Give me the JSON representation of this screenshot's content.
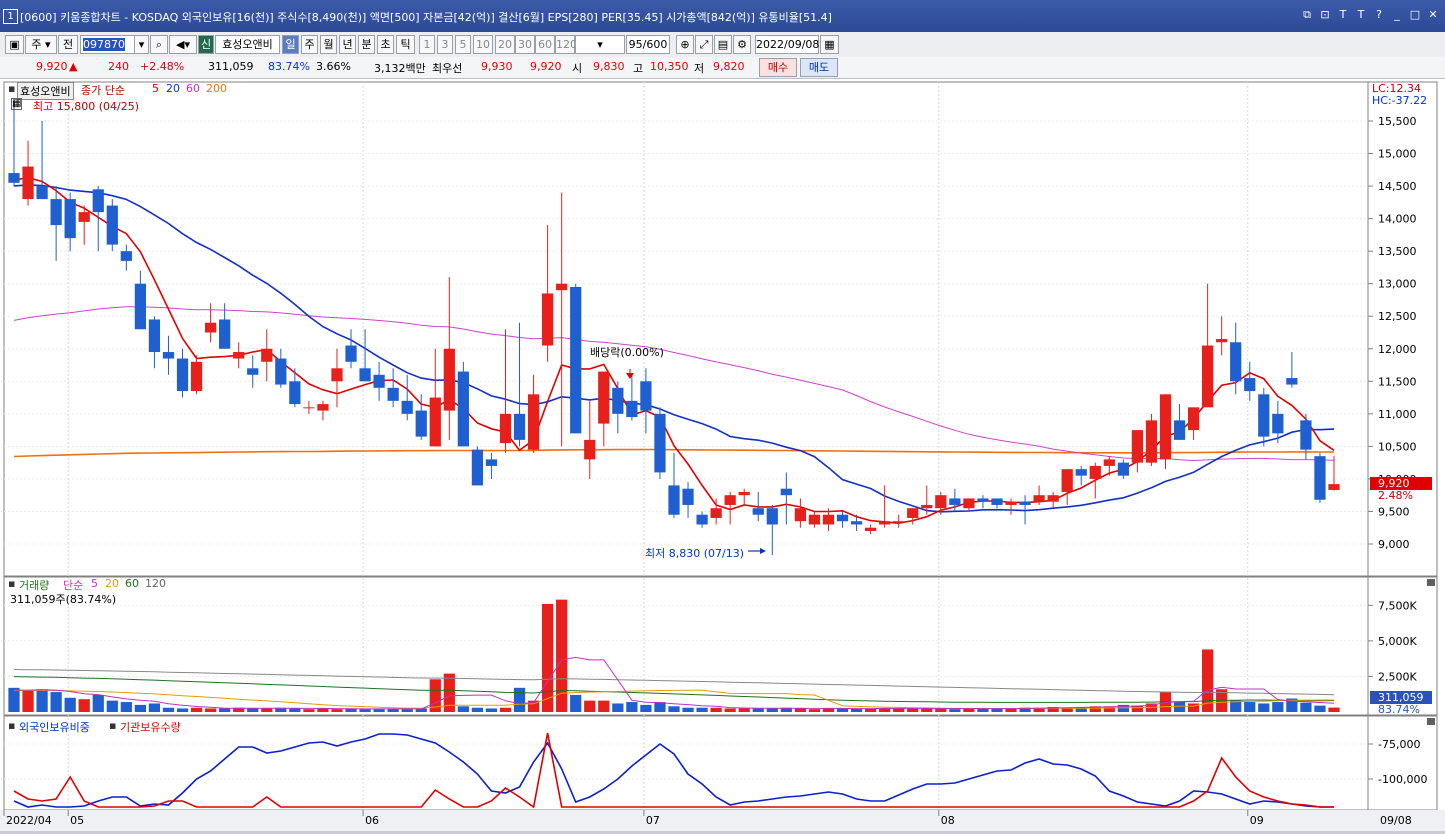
{
  "titlebar": {
    "number": "1",
    "title": "[0600] 키움종합차트 - KOSDAQ 외국인보유[16(천)] 주식수[8,490(천)] 액면[500] 자본금[42(억)] 결산[6월] EPS[280] PER[35.45] 시가총액[842(억)] 유통비율[51.4]",
    "buttons": [
      "⧉",
      "⊡",
      "T",
      "T",
      "?",
      "_",
      "□",
      "✕"
    ]
  },
  "toolbar": {
    "period_type": "주",
    "market": "전",
    "code": "097870",
    "stock_name": "효성오앤비",
    "new_badge": "신",
    "periods": [
      "일",
      "주",
      "월",
      "년",
      "분",
      "초",
      "틱"
    ],
    "active_period": "일",
    "intervals": [
      "1",
      "3",
      "5",
      "10",
      "20",
      "30",
      "60",
      "120"
    ],
    "count": "95",
    "max_count": "/600",
    "date": "2022/09/08"
  },
  "pricebar": {
    "price": "9,920",
    "arrow": "▲",
    "change": "240",
    "change_pct": "+2.48%",
    "volume": "311,059",
    "volume_ratio": "83.74%",
    "turnover": "3.66%",
    "amount": "3,132백만",
    "best_ask_label": "최우선",
    "best_ask": "9,930",
    "best_bid": "9,920",
    "open_label": "시",
    "open": "9,830",
    "high_label": "고",
    "high": "10,350",
    "low_label": "저",
    "low": "9,820",
    "buy_label": "매수",
    "sell_label": "매도"
  },
  "price_panel": {
    "legend_name": "효성오앤비",
    "legend_ma_label": "종가 단순",
    "ma_periods": [
      "5",
      "20",
      "60",
      "200"
    ],
    "high_note": "최고 15,800 (04/25)",
    "low_note": "최저 8,830 (07/13)",
    "dividend_note": "배당락(0.00%)",
    "lc": "LC:12.34",
    "hc": "HC:-37.22",
    "current_price_tag": "9,920",
    "current_pct_tag": "2.48%",
    "y_ticks": [
      "15,500",
      "15,000",
      "14,500",
      "14,000",
      "13,500",
      "13,000",
      "12,500",
      "12,000",
      "11,500",
      "11,000",
      "10,500",
      "10,000",
      "9,500",
      "9,000"
    ],
    "colors": {
      "up": "#e8201c",
      "down": "#1f5fd0",
      "ma5": "#e00000",
      "ma20": "#1030c8",
      "ma60": "#d040d0",
      "ma200": "#f07010"
    }
  },
  "volume_panel": {
    "legend_name": "거래량",
    "legend_ma_label": "단순",
    "ma_periods": [
      "5",
      "20",
      "60",
      "120"
    ],
    "sub_label": "311,059주(83.74%)",
    "y_ticks": [
      "7,500K",
      "5,000K",
      "2,500K"
    ],
    "current_tag": "311,059",
    "current_pct_tag": "83.74%"
  },
  "holding_panel": {
    "legend_foreign": "외국인보유비중",
    "legend_institution": "기관보유수량",
    "y_ticks": [
      "-75,000",
      "-100,000"
    ]
  },
  "x_axis": {
    "labels": [
      "2022/04",
      "05",
      "06",
      "07",
      "08",
      "09"
    ],
    "right_date": "09/08"
  },
  "chart_data": {
    "type": "candlestick",
    "ylim": [
      8500,
      16000
    ],
    "candles": [
      {
        "o": 14700,
        "h": 15800,
        "l": 14500,
        "c": 14550
      },
      {
        "o": 14300,
        "h": 15200,
        "l": 14200,
        "c": 14800
      },
      {
        "o": 14500,
        "h": 15500,
        "l": 14300,
        "c": 14300
      },
      {
        "o": 14300,
        "h": 14500,
        "l": 13350,
        "c": 13900
      },
      {
        "o": 14300,
        "h": 14400,
        "l": 13500,
        "c": 13700
      },
      {
        "o": 13950,
        "h": 14200,
        "l": 13600,
        "c": 14100
      },
      {
        "o": 14450,
        "h": 14500,
        "l": 13500,
        "c": 14100
      },
      {
        "o": 14200,
        "h": 14300,
        "l": 13500,
        "c": 13600
      },
      {
        "o": 13500,
        "h": 13600,
        "l": 13200,
        "c": 13350
      },
      {
        "o": 13000,
        "h": 13200,
        "l": 12300,
        "c": 12300
      },
      {
        "o": 12450,
        "h": 12500,
        "l": 11700,
        "c": 11950
      },
      {
        "o": 11950,
        "h": 12200,
        "l": 11600,
        "c": 11850
      },
      {
        "o": 11850,
        "h": 12000,
        "l": 11250,
        "c": 11350
      },
      {
        "o": 11350,
        "h": 11900,
        "l": 11300,
        "c": 11800
      },
      {
        "o": 12250,
        "h": 12700,
        "l": 12100,
        "c": 12400
      },
      {
        "o": 12450,
        "h": 12700,
        "l": 12000,
        "c": 12000
      },
      {
        "o": 11850,
        "h": 12100,
        "l": 11700,
        "c": 11950
      },
      {
        "o": 11700,
        "h": 11900,
        "l": 11400,
        "c": 11600
      },
      {
        "o": 11800,
        "h": 12300,
        "l": 11500,
        "c": 12000
      },
      {
        "o": 11850,
        "h": 12000,
        "l": 11400,
        "c": 11450
      },
      {
        "o": 11500,
        "h": 11700,
        "l": 11100,
        "c": 11150
      },
      {
        "o": 11100,
        "h": 11200,
        "l": 11000,
        "c": 11100
      },
      {
        "o": 11050,
        "h": 11200,
        "l": 10900,
        "c": 11150
      },
      {
        "o": 11500,
        "h": 12000,
        "l": 11100,
        "c": 11700
      },
      {
        "o": 12050,
        "h": 12300,
        "l": 11700,
        "c": 11800
      },
      {
        "o": 11700,
        "h": 12300,
        "l": 11500,
        "c": 11500
      },
      {
        "o": 11600,
        "h": 11800,
        "l": 11200,
        "c": 11400
      },
      {
        "o": 11400,
        "h": 11700,
        "l": 11100,
        "c": 11200
      },
      {
        "o": 11200,
        "h": 11600,
        "l": 10900,
        "c": 11000
      },
      {
        "o": 11050,
        "h": 11300,
        "l": 10600,
        "c": 10650
      },
      {
        "o": 10500,
        "h": 12000,
        "l": 10500,
        "c": 11250
      },
      {
        "o": 11050,
        "h": 13100,
        "l": 10600,
        "c": 12000
      },
      {
        "o": 11650,
        "h": 11800,
        "l": 10500,
        "c": 10500
      },
      {
        "o": 10450,
        "h": 10500,
        "l": 9900,
        "c": 9900
      },
      {
        "o": 10300,
        "h": 10400,
        "l": 10000,
        "c": 10200
      },
      {
        "o": 10550,
        "h": 12300,
        "l": 10400,
        "c": 11000
      },
      {
        "o": 11000,
        "h": 12400,
        "l": 10500,
        "c": 10600
      },
      {
        "o": 10450,
        "h": 11600,
        "l": 10400,
        "c": 11300
      },
      {
        "o": 12050,
        "h": 13900,
        "l": 11800,
        "c": 12850
      },
      {
        "o": 12900,
        "h": 14400,
        "l": 10500,
        "c": 13000
      },
      {
        "o": 12950,
        "h": 13000,
        "l": 10700,
        "c": 10700
      },
      {
        "o": 10300,
        "h": 11200,
        "l": 10000,
        "c": 10600
      },
      {
        "o": 10850,
        "h": 11300,
        "l": 10500,
        "c": 11650
      },
      {
        "o": 11400,
        "h": 11500,
        "l": 10700,
        "c": 11000
      },
      {
        "o": 11200,
        "h": 11600,
        "l": 10900,
        "c": 10950
      },
      {
        "o": 11500,
        "h": 11700,
        "l": 10700,
        "c": 11050
      },
      {
        "o": 11000,
        "h": 11100,
        "l": 10000,
        "c": 10100
      },
      {
        "o": 9900,
        "h": 10400,
        "l": 9400,
        "c": 9450
      },
      {
        "o": 9850,
        "h": 9950,
        "l": 9400,
        "c": 9600
      },
      {
        "o": 9450,
        "h": 9500,
        "l": 9250,
        "c": 9300
      },
      {
        "o": 9400,
        "h": 9700,
        "l": 9300,
        "c": 9550
      },
      {
        "o": 9600,
        "h": 9800,
        "l": 9300,
        "c": 9750
      },
      {
        "o": 9750,
        "h": 9850,
        "l": 9600,
        "c": 9800
      },
      {
        "o": 9550,
        "h": 9800,
        "l": 9350,
        "c": 9450
      },
      {
        "o": 9550,
        "h": 9600,
        "l": 8830,
        "c": 9300
      },
      {
        "o": 9850,
        "h": 10100,
        "l": 9300,
        "c": 9750
      },
      {
        "o": 9350,
        "h": 9700,
        "l": 9250,
        "c": 9550
      },
      {
        "o": 9300,
        "h": 9500,
        "l": 9250,
        "c": 9450
      },
      {
        "o": 9300,
        "h": 9550,
        "l": 9200,
        "c": 9450
      },
      {
        "o": 9450,
        "h": 9500,
        "l": 9250,
        "c": 9350
      },
      {
        "o": 9350,
        "h": 9450,
        "l": 9200,
        "c": 9300
      },
      {
        "o": 9200,
        "h": 9300,
        "l": 9150,
        "c": 9250
      },
      {
        "o": 9300,
        "h": 9900,
        "l": 9250,
        "c": 9350
      },
      {
        "o": 9350,
        "h": 9450,
        "l": 9250,
        "c": 9350
      },
      {
        "o": 9400,
        "h": 9550,
        "l": 9300,
        "c": 9550
      },
      {
        "o": 9550,
        "h": 9900,
        "l": 9450,
        "c": 9600
      },
      {
        "o": 9550,
        "h": 9800,
        "l": 9450,
        "c": 9750
      },
      {
        "o": 9700,
        "h": 9850,
        "l": 9500,
        "c": 9600
      },
      {
        "o": 9550,
        "h": 9700,
        "l": 9500,
        "c": 9700
      },
      {
        "o": 9700,
        "h": 9750,
        "l": 9550,
        "c": 9650
      },
      {
        "o": 9700,
        "h": 9700,
        "l": 9550,
        "c": 9600
      },
      {
        "o": 9600,
        "h": 9700,
        "l": 9450,
        "c": 9650
      },
      {
        "o": 9650,
        "h": 9750,
        "l": 9300,
        "c": 9600
      },
      {
        "o": 9650,
        "h": 9900,
        "l": 9600,
        "c": 9750
      },
      {
        "o": 9650,
        "h": 9800,
        "l": 9550,
        "c": 9750
      },
      {
        "o": 9800,
        "h": 10100,
        "l": 9600,
        "c": 10150
      },
      {
        "o": 10150,
        "h": 10200,
        "l": 9900,
        "c": 10050
      },
      {
        "o": 10000,
        "h": 10250,
        "l": 9700,
        "c": 10200
      },
      {
        "o": 10200,
        "h": 10350,
        "l": 10050,
        "c": 10300
      },
      {
        "o": 10250,
        "h": 10300,
        "l": 10000,
        "c": 10050
      },
      {
        "o": 10250,
        "h": 10600,
        "l": 10100,
        "c": 10750
      },
      {
        "o": 10250,
        "h": 11000,
        "l": 10200,
        "c": 10900
      },
      {
        "o": 10300,
        "h": 11300,
        "l": 10150,
        "c": 11300
      },
      {
        "o": 10900,
        "h": 11150,
        "l": 10600,
        "c": 10600
      },
      {
        "o": 10750,
        "h": 10950,
        "l": 10600,
        "c": 11100
      },
      {
        "o": 11100,
        "h": 13000,
        "l": 11100,
        "c": 12050
      },
      {
        "o": 12100,
        "h": 12500,
        "l": 11900,
        "c": 12150
      },
      {
        "o": 12100,
        "h": 12400,
        "l": 11300,
        "c": 11500
      },
      {
        "o": 11550,
        "h": 11800,
        "l": 11200,
        "c": 11350
      },
      {
        "o": 11300,
        "h": 11400,
        "l": 10500,
        "c": 10650
      },
      {
        "o": 11000,
        "h": 11200,
        "l": 10550,
        "c": 10700
      },
      {
        "o": 11550,
        "h": 11950,
        "l": 11400,
        "c": 11450
      },
      {
        "o": 10900,
        "h": 11000,
        "l": 10300,
        "c": 10450
      },
      {
        "o": 10350,
        "h": 10400,
        "l": 9630,
        "c": 9680
      },
      {
        "o": 9830,
        "h": 10350,
        "l": 9820,
        "c": 9920
      }
    ],
    "volume_ylim": [
      0,
      9000
    ],
    "volumes": [
      1700,
      1500,
      1600,
      1400,
      1000,
      900,
      1200,
      800,
      700,
      500,
      600,
      300,
      250,
      300,
      250,
      250,
      300,
      250,
      250,
      300,
      250,
      200,
      250,
      200,
      250,
      200,
      200,
      250,
      200,
      250,
      2300,
      2700,
      400,
      300,
      250,
      300,
      1700,
      800,
      7600,
      7900,
      1200,
      800,
      800,
      600,
      700,
      500,
      700,
      400,
      300,
      300,
      300,
      250,
      250,
      250,
      250,
      300,
      250,
      200,
      250,
      250,
      250,
      250,
      250,
      250,
      250,
      250,
      250,
      200,
      250,
      250,
      250,
      250,
      300,
      300,
      350,
      300,
      350,
      400,
      400,
      500,
      450,
      600,
      1400,
      700,
      600,
      4400,
      1600,
      800,
      700,
      600,
      700,
      950,
      650,
      450,
      311
    ]
  }
}
